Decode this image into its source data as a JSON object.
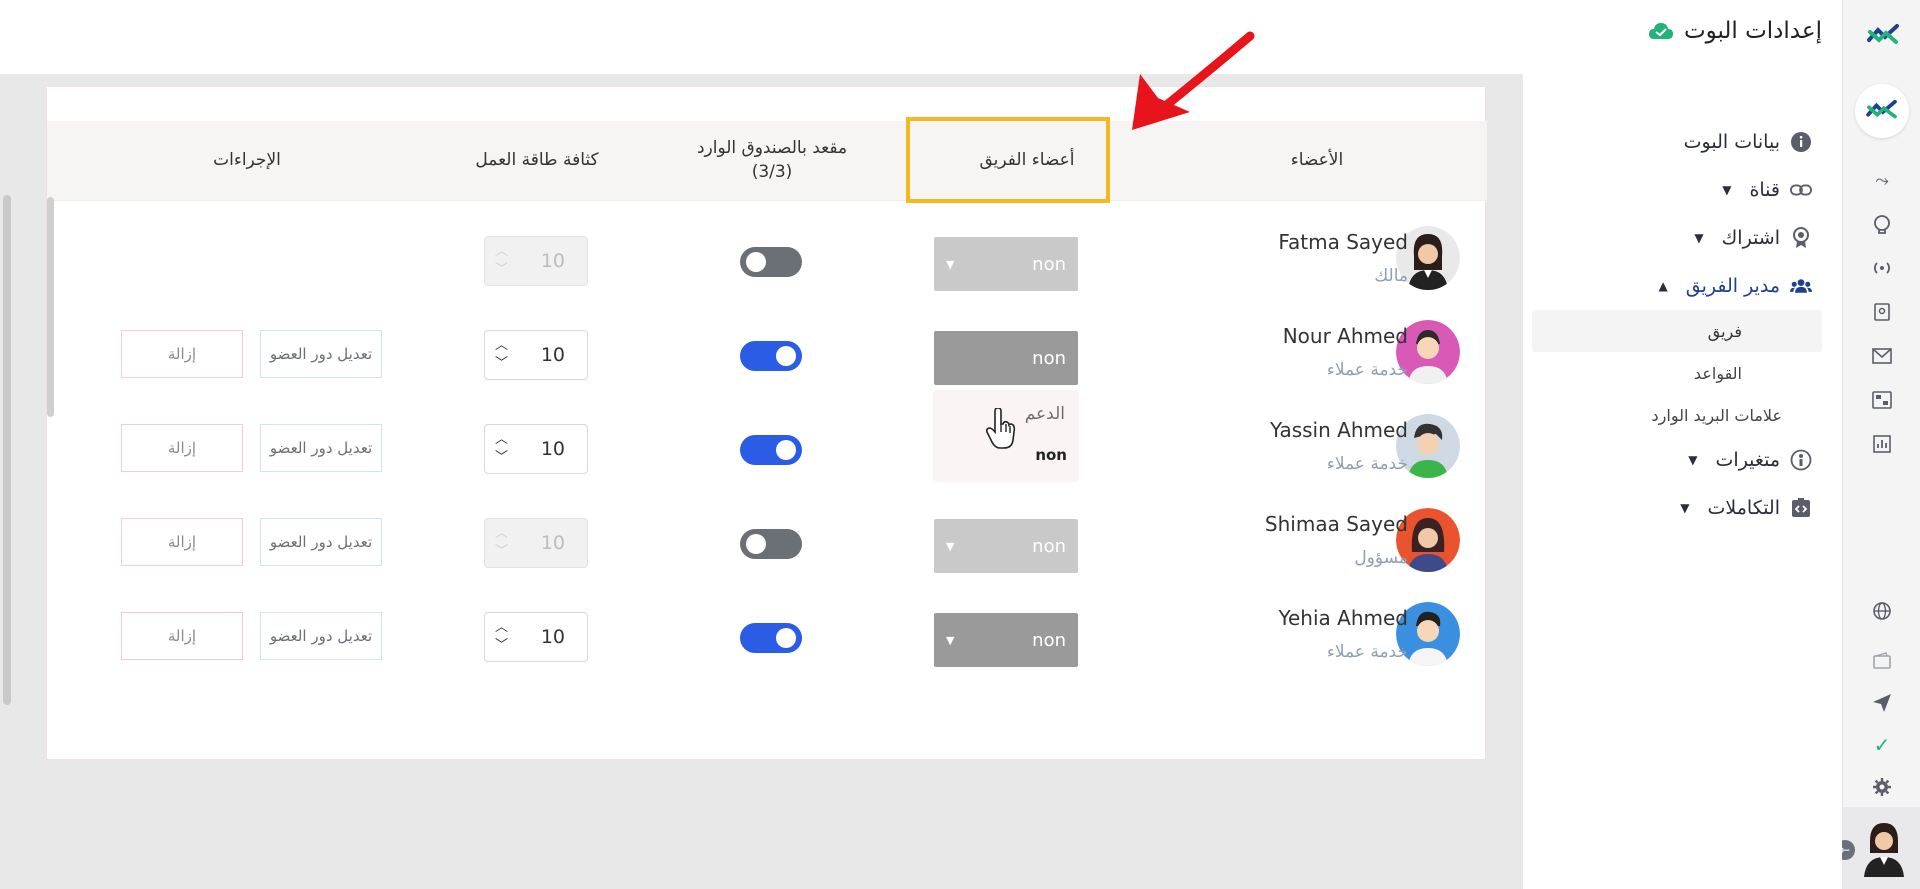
{
  "app": {
    "title": "إعدادات البوت"
  },
  "sidebar": {
    "items": [
      {
        "label": "بيانات البوت",
        "icon": "info-icon"
      },
      {
        "label": "قناة",
        "icon": "link-icon"
      },
      {
        "label": "اشتراك",
        "icon": "badge-icon"
      },
      {
        "label": "مدير الفريق",
        "icon": "users-icon"
      },
      {
        "label": "متغيرات",
        "icon": "variable-icon"
      },
      {
        "label": "التكاملات",
        "icon": "integration-icon"
      }
    ],
    "subitems": [
      {
        "label": "فريق"
      },
      {
        "label": "القواعد"
      },
      {
        "label": "علامات البريد الوارد"
      }
    ]
  },
  "table": {
    "headers": {
      "members": "الأعضاء",
      "team_members": "أعضاء الفريق",
      "inbox_seat_line1": "مقعد بالصندوق الوارد",
      "inbox_seat_line2": "(3/3)",
      "workload": "كثافة طاقة العمل",
      "actions": "الإجراءات"
    },
    "actions": {
      "edit_label": "تعديل دور العضو",
      "remove_label": "إزالة"
    },
    "rows": [
      {
        "name": "Fatma Sayed",
        "role": "مالك",
        "team": "non",
        "inbox_seat": false,
        "workload": "10",
        "editable": false
      },
      {
        "name": "Nour Ahmed",
        "role": "خدمة عملاء",
        "team": "non",
        "inbox_seat": true,
        "workload": "10",
        "editable": true
      },
      {
        "name": "Yassin Ahmed",
        "role": "خدمة عملاء",
        "team": "non",
        "inbox_seat": true,
        "workload": "10",
        "editable": true
      },
      {
        "name": "Shimaa Sayed",
        "role": "مسؤول",
        "team": "non",
        "inbox_seat": false,
        "workload": "10",
        "editable": true
      },
      {
        "name": "Yehia Ahmed",
        "role": "خدمة عملاء",
        "team": "non",
        "inbox_seat": true,
        "workload": "10",
        "editable": true
      }
    ]
  },
  "dropdown": {
    "options": [
      "الدعم",
      "non"
    ]
  },
  "colors": {
    "accent": "#2b5ce6",
    "highlight": "#f5b81e",
    "arrow": "#e8141c",
    "brand_green": "#20b37a"
  }
}
